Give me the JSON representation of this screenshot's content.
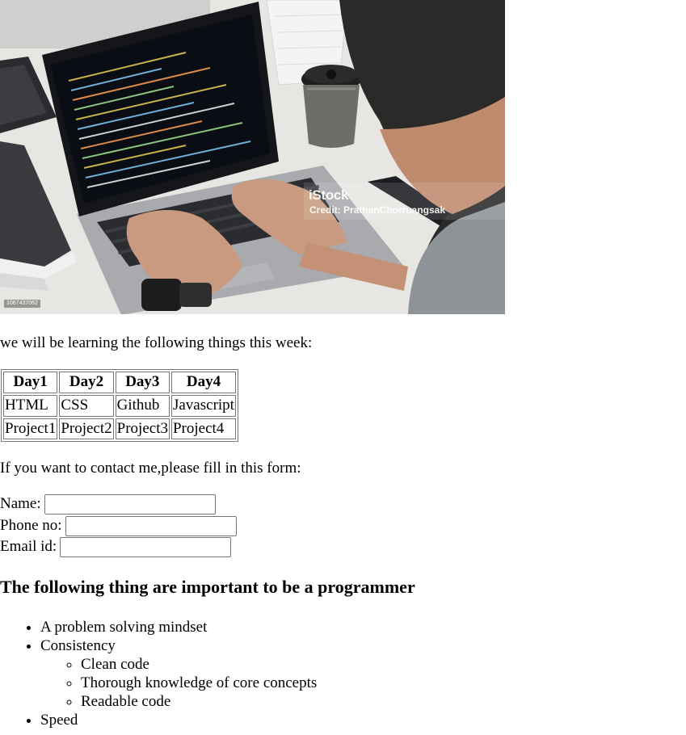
{
  "image": {
    "watermark_brand": "iStock",
    "watermark_credit": "Credit: PrathanChorruangsak",
    "watermark_id": "1067437062"
  },
  "intro_text": "we will be learning the following things this week:",
  "schedule": {
    "headers": [
      "Day1",
      "Day2",
      "Day3",
      "Day4"
    ],
    "rows": [
      [
        "HTML",
        "CSS",
        "Github",
        "Javascript"
      ],
      [
        "Project1",
        "Project2",
        "Project3",
        "Project4"
      ]
    ]
  },
  "contact_text": "If you want to contact me,please fill in this form:",
  "form": {
    "name_label": "Name:",
    "phone_label": "Phone no:",
    "email_label": "Email id:",
    "name_value": "",
    "phone_value": "",
    "email_value": ""
  },
  "heading": "The following thing are important to be a programmer",
  "list": {
    "item1": "A problem solving mindset",
    "item2": "Consistency",
    "sub1": "Clean code",
    "sub2": "Thorough knowledge of core concepts",
    "sub3": "Readable code",
    "item3": "Speed"
  }
}
